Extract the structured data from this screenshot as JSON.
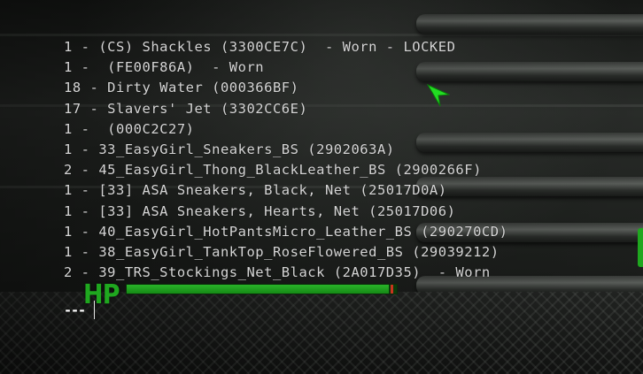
{
  "console": {
    "lines": [
      "1 - (CS) Shackles (3300CE7C)  - Worn - LOCKED",
      "1 -  (FE00F86A)  - Worn",
      "18 - Dirty Water (000366BF)",
      "17 - Slavers' Jet (3302CC6E)",
      "1 -  (000C2C27)",
      "1 - 33_EasyGirl_Sneakers_BS (2902063A)",
      "2 - 45_EasyGirl_Thong_BlackLeather_BS (2900266F)",
      "1 - [33] ASA Sneakers, Black, Net (25017D0A)",
      "1 - [33] ASA Sneakers, Hearts, Net (25017D06)",
      "1 - 40_EasyGirl_HotPantsMicro_Leather_BS (290270CD)",
      "1 - 38_EasyGirl_TankTop_RoseFlowered_BS (29039212)",
      "2 - 39_TRS_Stockings_Net_Black (2A017D35)  - Worn"
    ],
    "prompt": "---",
    "input_value": ""
  },
  "hud": {
    "hp_label": "HP",
    "hp_fraction": 0.97,
    "hud_color": "#1fa71f"
  },
  "icons": {
    "cursor": "pointer-arrow-icon"
  },
  "colors": {
    "console_text": "#d6d6d6",
    "hud_green": "#1fa71f",
    "cursor_green": "#22dd22",
    "hp_bar_marker": "#c8341f"
  }
}
